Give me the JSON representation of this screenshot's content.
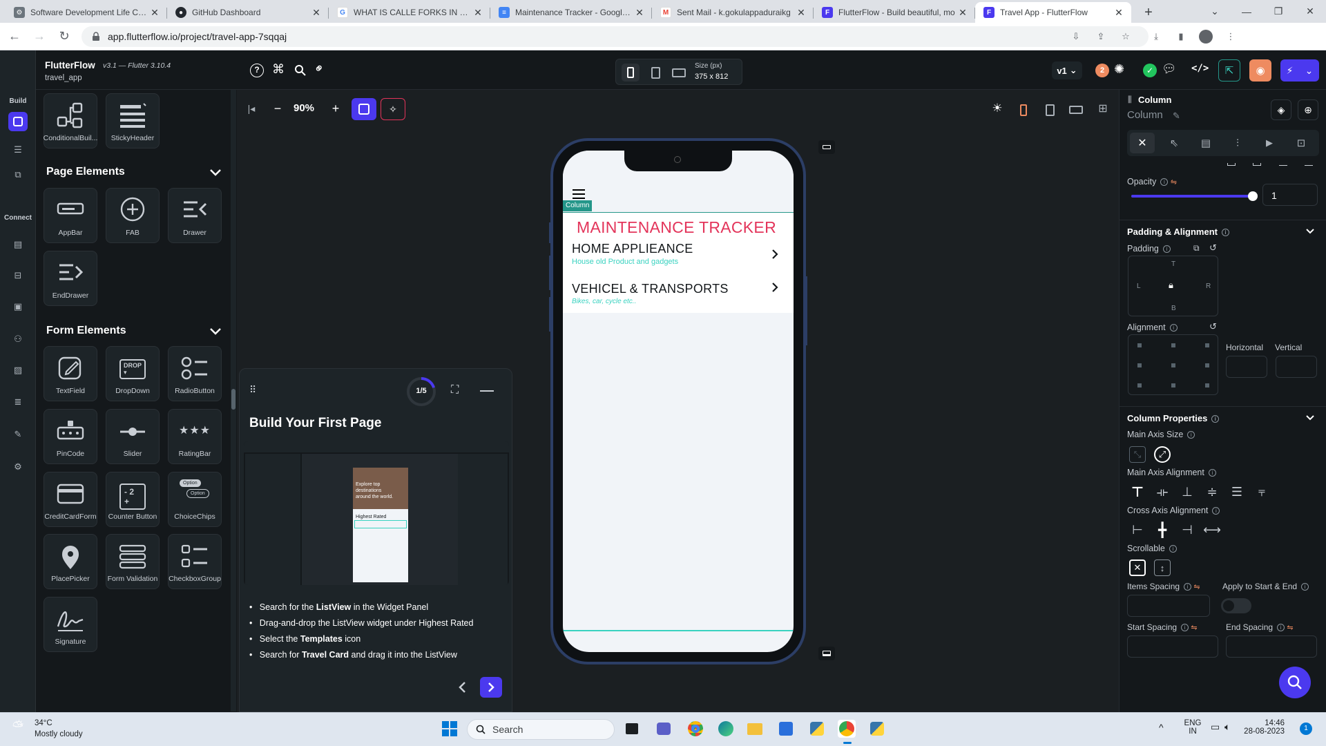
{
  "browser": {
    "tabs": [
      {
        "title": "Software Development Life Cycle",
        "favicon": "gear-icon",
        "color": "#6c757d"
      },
      {
        "title": "GitHub Dashboard",
        "favicon": "github-icon",
        "color": "#24292f"
      },
      {
        "title": "WHAT IS CALLE FORKS IN GITHUB",
        "favicon": "google-icon",
        "color": "#4285f4"
      },
      {
        "title": "Maintenance Tracker - Google Docs",
        "favicon": "docs-icon",
        "color": "#4285f4"
      },
      {
        "title": "Sent Mail - k.gokulappaduraikg",
        "favicon": "gmail-icon",
        "color": "#ea4335"
      },
      {
        "title": "FlutterFlow - Build beautiful, mo",
        "favicon": "flutterflow-icon",
        "color": "#4b39ef"
      },
      {
        "title": "Travel App - FlutterFlow",
        "favicon": "flutterflow-icon",
        "color": "#4b39ef"
      }
    ],
    "url": "app.flutterflow.io/project/travel-app-7sqqaj"
  },
  "app": {
    "brand": "FlutterFlow",
    "version": "v3.1 — Flutter 3.10.4",
    "project": "travel_app",
    "rail": {
      "build_label": "Build",
      "connect_label": "Connect"
    },
    "device": {
      "size_label": "Size (px)",
      "size_value": "375 x 812"
    },
    "version_badge": "v1",
    "warning_count": "2",
    "zoom": "90%"
  },
  "widgets": {
    "top_items": [
      {
        "label": "ConditionalBuil...",
        "icon": "conditional-builder-icon"
      },
      {
        "label": "StickyHeader",
        "icon": "sticky-header-icon"
      }
    ],
    "page_elements_title": "Page Elements",
    "page_elements": [
      {
        "label": "AppBar",
        "icon": "appbar-icon"
      },
      {
        "label": "FAB",
        "icon": "fab-icon"
      },
      {
        "label": "Drawer",
        "icon": "drawer-icon"
      },
      {
        "label": "EndDrawer",
        "icon": "end-drawer-icon"
      }
    ],
    "form_elements_title": "Form Elements",
    "form_elements": [
      {
        "label": "TextField",
        "icon": "textfield-icon"
      },
      {
        "label": "DropDown",
        "icon": "dropdown-icon"
      },
      {
        "label": "RadioButton",
        "icon": "radio-button-icon"
      },
      {
        "label": "PinCode",
        "icon": "pincode-icon"
      },
      {
        "label": "Slider",
        "icon": "slider-icon"
      },
      {
        "label": "RatingBar",
        "icon": "rating-bar-icon"
      },
      {
        "label": "CreditCardForm",
        "icon": "credit-card-icon"
      },
      {
        "label": "Counter Button",
        "icon": "counter-button-icon"
      },
      {
        "label": "ChoiceChips",
        "icon": "choice-chips-icon"
      },
      {
        "label": "PlacePicker",
        "icon": "place-picker-icon"
      },
      {
        "label": "Form Validation",
        "icon": "form-validation-icon"
      },
      {
        "label": "CheckboxGroup",
        "icon": "checkbox-group-icon"
      },
      {
        "label": "Signature",
        "icon": "signature-icon"
      }
    ],
    "dropdown_icon_text": "DROP",
    "counter_icon_text": "- 2 +",
    "chip_icon_text": "Option"
  },
  "phone": {
    "selected_tag": "Column",
    "title": "MAINTENANCE TRACKER",
    "items": [
      {
        "title": "HOME  APPLIEANCE",
        "subtitle": "House old Product and gadgets"
      },
      {
        "title": "VEHICEL & TRANSPORTS",
        "subtitle": "Bikes, car, cycle etc.."
      }
    ]
  },
  "tutorial": {
    "progress": "1/5",
    "progress_fraction": 0.2,
    "title": "Build Your First Page",
    "preview_card_text": "Explore top destinations around the world.",
    "preview_card_label": "Highest Rated",
    "steps": [
      {
        "pre": "Search for the ",
        "bold": "ListView",
        "post": " in the Widget Panel"
      },
      {
        "pre": "Drag-and-drop the ListView widget under Highest Rated",
        "bold": "",
        "post": ""
      },
      {
        "pre": "Select the ",
        "bold": "Templates",
        "post": " icon"
      },
      {
        "pre": "Search for ",
        "bold": "Travel Card",
        "post": " and drag it into the ListView"
      }
    ]
  },
  "properties": {
    "widget_type": "Column",
    "widget_name": "Column",
    "opacity_label": "Opacity",
    "opacity_value": "1",
    "opacity_fraction": 1.0,
    "padding_alignment_title": "Padding & Alignment",
    "padding_label": "Padding",
    "pad_t": "T",
    "pad_l": "L",
    "pad_r": "R",
    "pad_b": "B",
    "alignment_label": "Alignment",
    "horizontal_label": "Horizontal",
    "vertical_label": "Vertical",
    "column_props_title": "Column Properties",
    "main_axis_size_label": "Main Axis Size",
    "main_axis_alignment_label": "Main Axis Alignment",
    "cross_axis_alignment_label": "Cross Axis Alignment",
    "scrollable_label": "Scrollable",
    "items_spacing_label": "Items Spacing",
    "apply_start_end_label": "Apply to Start & End",
    "start_spacing_label": "Start Spacing",
    "end_spacing_label": "End Spacing"
  },
  "taskbar": {
    "weather_temp": "34°C",
    "weather_desc": "Mostly cloudy",
    "search_placeholder": "Search",
    "lang_top": "ENG",
    "lang_bottom": "IN",
    "time": "14:46",
    "date": "28-08-2023",
    "notification_count": "1"
  },
  "colors": {
    "accent": "#4b39ef",
    "phone_title": "#e3345a",
    "phone_subtitle": "#39d2c0",
    "selected_tag": "#249689",
    "warning": "#ee8b60",
    "success": "#22c55e"
  }
}
